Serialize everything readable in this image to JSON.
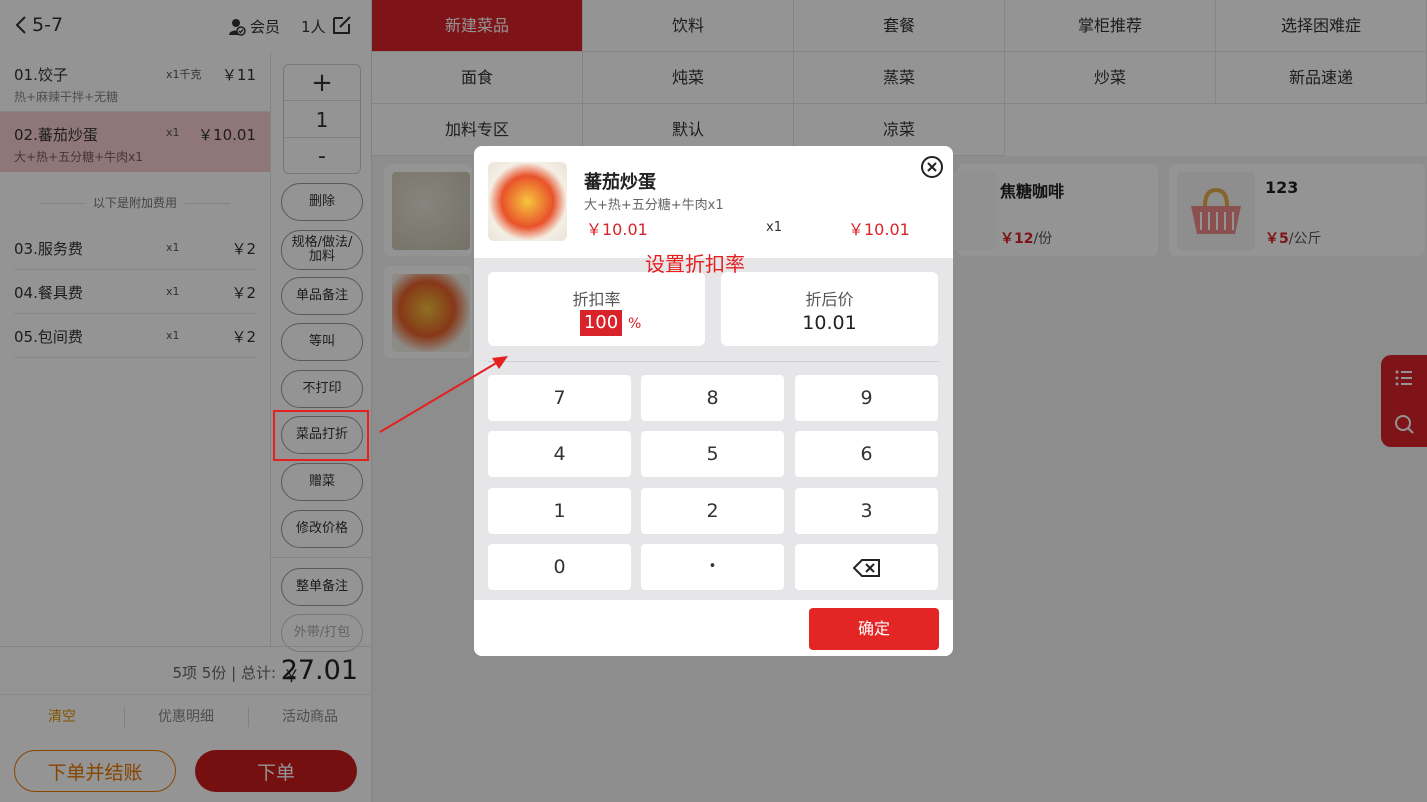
{
  "header": {
    "table_no": "5-7",
    "member_label": "会员",
    "people": "1人"
  },
  "order": {
    "items": [
      {
        "name": "01.饺子",
        "qty": "x1千克",
        "price": "￥11",
        "spec": "热+麻辣干拌+无糖"
      },
      {
        "name": "02.蕃茄炒蛋",
        "qty": "x1",
        "price": "￥10.01",
        "spec": "大+热+五分糖+牛肉x1",
        "selected": true
      }
    ],
    "extra_label": "以下是附加费用",
    "fees": [
      {
        "name": "03.服务费",
        "qty": "x1",
        "price": "￥2"
      },
      {
        "name": "04.餐具费",
        "qty": "x1",
        "price": "￥2"
      },
      {
        "name": "05.包间费",
        "qty": "x1",
        "price": "￥2"
      }
    ]
  },
  "stepper": {
    "plus": "+",
    "value": "1",
    "minus": "-"
  },
  "ops": {
    "delete": "删除",
    "spec": "规格/做法/加料",
    "note": "单品备注",
    "wait": "等叫",
    "no_print": "不打印",
    "discount": "菜品打折",
    "gift": "赠菜",
    "edit_price": "修改价格",
    "order_note": "整单备注",
    "takeaway": "外带/打包"
  },
  "totals": {
    "summary": "5项 5份 | 总计:",
    "currency": "￥",
    "amount": "27.01"
  },
  "bottom_tabs": {
    "clear": "清空",
    "discount_detail": "优惠明细",
    "promo": "活动商品"
  },
  "actions": {
    "pay": "下单并结账",
    "order": "下单"
  },
  "categories": [
    {
      "label": "新建菜品",
      "active": true
    },
    {
      "label": "饮料"
    },
    {
      "label": "套餐"
    },
    {
      "label": "掌柜推荐"
    },
    {
      "label": "选择困难症"
    },
    {
      "label": "面食"
    },
    {
      "label": "炖菜"
    },
    {
      "label": "蒸菜"
    },
    {
      "label": "炒菜"
    },
    {
      "label": "新品速递"
    },
    {
      "label": "加料专区"
    },
    {
      "label": "默认"
    },
    {
      "label": "凉菜"
    }
  ],
  "goods": [
    {
      "name": "焦糖咖啡",
      "price": "￥12",
      "unit": "/份"
    },
    {
      "name": "123",
      "price": "￥5",
      "unit": "/公斤"
    }
  ],
  "dialog": {
    "dish_name": "蕃茄炒蛋",
    "spec": "大+热+五分糖+牛肉x1",
    "price": "￥10.01",
    "qty": "x1",
    "total": "￥10.01",
    "rate_label": "折扣率",
    "rate_value": "100",
    "rate_unit": "%",
    "after_label": "折后价",
    "after_value": "10.01",
    "keys": [
      "7",
      "8",
      "9",
      "4",
      "5",
      "6",
      "1",
      "2",
      "3",
      "0",
      "•"
    ],
    "confirm": "确定"
  },
  "annotation": "设置折扣率",
  "colors": {
    "accent": "#d9232a",
    "orange": "#e87800",
    "selected_row": "#f6cdd0"
  }
}
